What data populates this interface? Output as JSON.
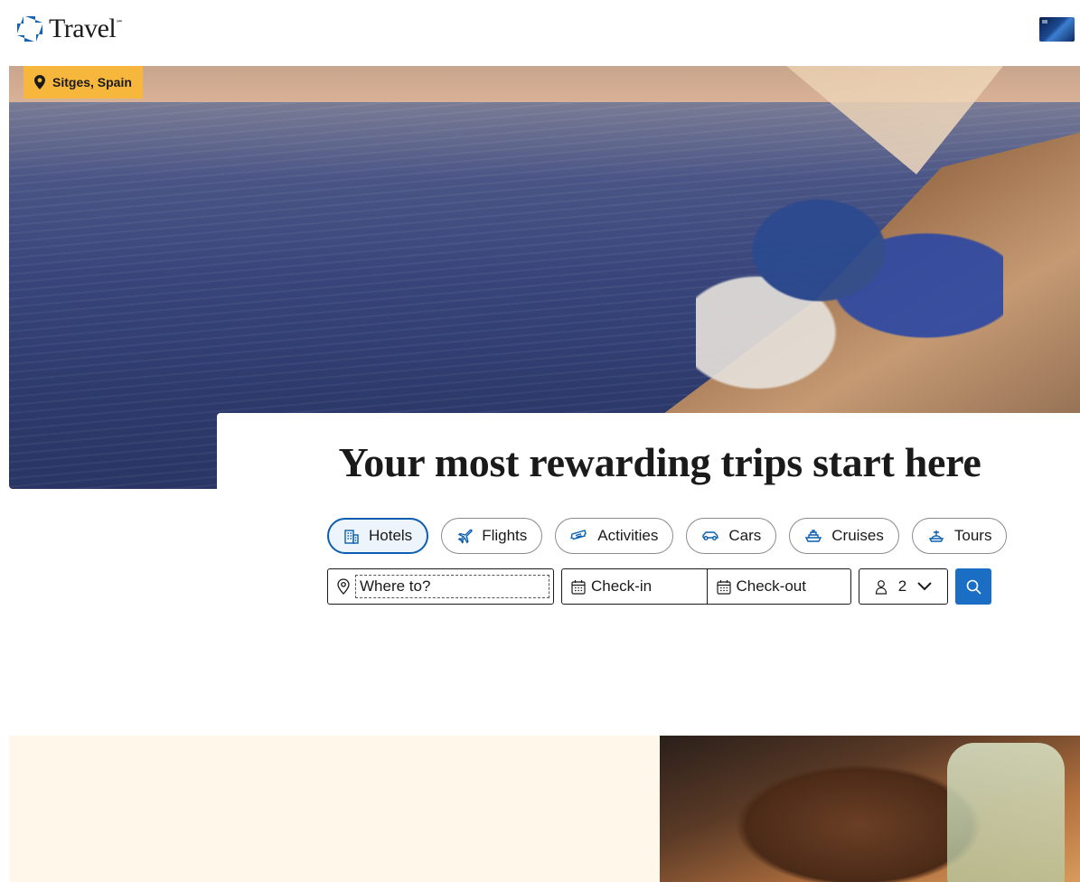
{
  "header": {
    "logo_text": "Travel",
    "logo_tm": "℠",
    "logo_icon": "octagon-logo-icon",
    "account_card": "credit-card-thumbnail"
  },
  "hero": {
    "location": "Sitges, Spain",
    "location_icon": "map-pin-icon",
    "badge_color": "#f6b73c"
  },
  "search": {
    "headline": "Your most rewarding trips start here",
    "tabs": [
      {
        "label": "Hotels",
        "icon": "hotel-icon",
        "active": true
      },
      {
        "label": "Flights",
        "icon": "plane-icon",
        "active": false
      },
      {
        "label": "Activities",
        "icon": "ticket-icon",
        "active": false
      },
      {
        "label": "Cars",
        "icon": "car-icon",
        "active": false
      },
      {
        "label": "Cruises",
        "icon": "ship-icon",
        "active": false
      },
      {
        "label": "Tours",
        "icon": "tour-icon",
        "active": false
      }
    ],
    "where_placeholder": "Where to?",
    "checkin_placeholder": "Check-in",
    "checkout_placeholder": "Check-out",
    "guests_value": "2",
    "accent_color": "#0a5eb0",
    "search_button_color": "#1a6ec4"
  }
}
